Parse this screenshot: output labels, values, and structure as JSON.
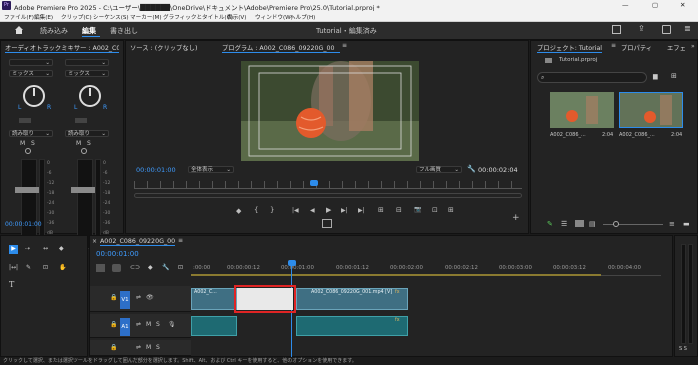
{
  "titlebar": {
    "app_icon": "Pr",
    "title": "Adobe Premiere Pro 2025 - C:\\ユーザー\\██████\\OneDrive\\ドキュメント\\Adobe\\Premiere Pro\\25.0\\Tutorial.prproj *",
    "min": "—",
    "max": "▢",
    "close": "✕"
  },
  "menu": [
    "ファイル(F)",
    "編集(E)",
    "クリップ(C)",
    "シーケンス(S)",
    "マーカー(M)",
    "グラフィックとタイトル(G)",
    "表示(V)",
    "ウィンドウ(W)",
    "ヘルプ(H)"
  ],
  "workspace": {
    "home_icon": "home-icon",
    "tabs": [
      "読み込み",
      "編集",
      "書き出し"
    ],
    "active_tab": "編集",
    "center_title": "Tutorial・編集済み"
  },
  "mixer": {
    "title": "オーディオトラックミキサー : A002_C086_0922C",
    "menu_icon": "≡",
    "channels": [
      {
        "mode": "ミックス",
        "lr": [
          "L",
          "R"
        ],
        "read": "読み取り",
        "ms": [
          "M",
          "S"
        ],
        "scale": [
          "0",
          "-6",
          "-12",
          "-18",
          "-24",
          "-30",
          "-36",
          "dB"
        ]
      },
      {
        "mode": "ミックス",
        "lr": [
          "L",
          "R"
        ],
        "read": "読み取り",
        "ms": [
          "M",
          "S"
        ],
        "scale": [
          "0",
          "-6",
          "-12",
          "-18",
          "-24",
          "-30",
          "-36",
          "dB"
        ]
      }
    ],
    "timecode": "00:00:01:00"
  },
  "source": {
    "title": "ソース : (クリップなし)"
  },
  "program": {
    "title": "プログラム : A002_C086_09220G_00",
    "menu_icon": "≡",
    "timecode_in": "00:00:01:00",
    "fit": "全体表示",
    "quality": "フル画質",
    "timecode_total": "00:00:02:04",
    "controls": [
      "◆",
      "{",
      "}",
      "|◀",
      "◀|",
      "◀",
      "▶",
      "▶|",
      "▶|",
      "⊞",
      "⊟",
      "📷",
      "⊡",
      "⊞",
      "⊕"
    ]
  },
  "project": {
    "tabs": [
      "プロジェクト: Tutorial",
      "プロパティ",
      "エフェ"
    ],
    "menu_icon": "≡",
    "file": "Tutorial.prproj",
    "items": [
      {
        "name": "A002_C086_...",
        "dur": "2:04"
      },
      {
        "name": "A002_C086_...",
        "dur": "2:04"
      }
    ],
    "more": "»"
  },
  "timeline": {
    "title": "A002_C086_09220G_00",
    "menu_icon": "≡",
    "timecode": "00:00:01:00",
    "ruler": [
      ":00:00",
      "00:00:00:12",
      "00:00:01:00",
      "00:00:01:12",
      "00:00:02:00",
      "00:00:02:12",
      "00:00:03:00",
      "00:00:03:12",
      "00:00:04:00",
      "00:00:04:12"
    ],
    "tracks": [
      {
        "id": "V1",
        "label": "V1"
      },
      {
        "id": "A1",
        "label": "A1",
        "ms": [
          "M",
          "S"
        ]
      }
    ],
    "clip_v1_a": "A002_C...",
    "clip_v1_b": "A002_C086_09220G_001.mp4 [V]",
    "fx": "fx"
  },
  "tools": [
    "▶",
    "⇢",
    "↔",
    "◆",
    "|↔|",
    "✎",
    "⊡",
    "✋",
    "T"
  ],
  "status": "クリックして選択、または選択ツールをドラッグして囲んだ部分を選択します。Shift、Alt、および Ctrl キーを使用すると、他のオプションを使用できます。",
  "colors": {
    "accent": "#2d8ceb",
    "highlight": "#e02424",
    "clip": "#3f6f83"
  }
}
